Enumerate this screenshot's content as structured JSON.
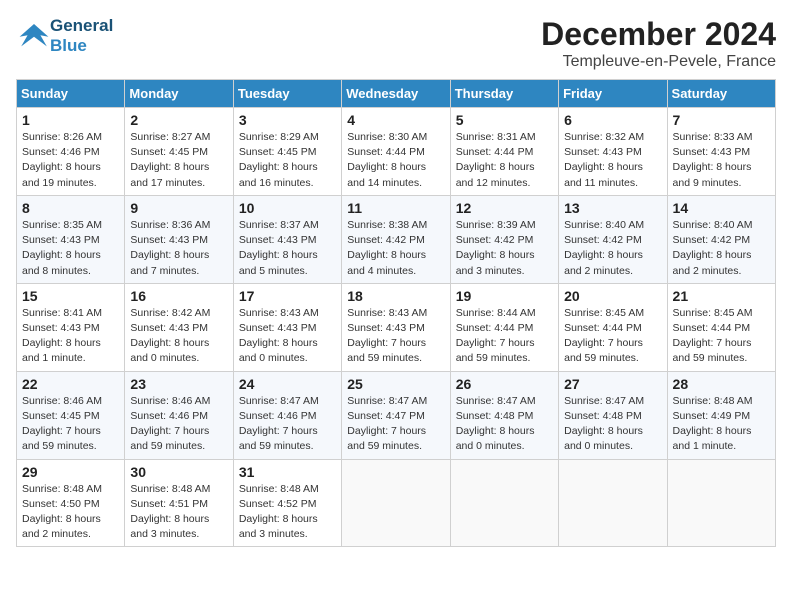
{
  "header": {
    "logo_general": "General",
    "logo_blue": "Blue",
    "month_title": "December 2024",
    "location": "Templeuve-en-Pevele, France"
  },
  "weekdays": [
    "Sunday",
    "Monday",
    "Tuesday",
    "Wednesday",
    "Thursday",
    "Friday",
    "Saturday"
  ],
  "weeks": [
    [
      {
        "day": "1",
        "info": "Sunrise: 8:26 AM\nSunset: 4:46 PM\nDaylight: 8 hours\nand 19 minutes."
      },
      {
        "day": "2",
        "info": "Sunrise: 8:27 AM\nSunset: 4:45 PM\nDaylight: 8 hours\nand 17 minutes."
      },
      {
        "day": "3",
        "info": "Sunrise: 8:29 AM\nSunset: 4:45 PM\nDaylight: 8 hours\nand 16 minutes."
      },
      {
        "day": "4",
        "info": "Sunrise: 8:30 AM\nSunset: 4:44 PM\nDaylight: 8 hours\nand 14 minutes."
      },
      {
        "day": "5",
        "info": "Sunrise: 8:31 AM\nSunset: 4:44 PM\nDaylight: 8 hours\nand 12 minutes."
      },
      {
        "day": "6",
        "info": "Sunrise: 8:32 AM\nSunset: 4:43 PM\nDaylight: 8 hours\nand 11 minutes."
      },
      {
        "day": "7",
        "info": "Sunrise: 8:33 AM\nSunset: 4:43 PM\nDaylight: 8 hours\nand 9 minutes."
      }
    ],
    [
      {
        "day": "8",
        "info": "Sunrise: 8:35 AM\nSunset: 4:43 PM\nDaylight: 8 hours\nand 8 minutes."
      },
      {
        "day": "9",
        "info": "Sunrise: 8:36 AM\nSunset: 4:43 PM\nDaylight: 8 hours\nand 7 minutes."
      },
      {
        "day": "10",
        "info": "Sunrise: 8:37 AM\nSunset: 4:43 PM\nDaylight: 8 hours\nand 5 minutes."
      },
      {
        "day": "11",
        "info": "Sunrise: 8:38 AM\nSunset: 4:42 PM\nDaylight: 8 hours\nand 4 minutes."
      },
      {
        "day": "12",
        "info": "Sunrise: 8:39 AM\nSunset: 4:42 PM\nDaylight: 8 hours\nand 3 minutes."
      },
      {
        "day": "13",
        "info": "Sunrise: 8:40 AM\nSunset: 4:42 PM\nDaylight: 8 hours\nand 2 minutes."
      },
      {
        "day": "14",
        "info": "Sunrise: 8:40 AM\nSunset: 4:42 PM\nDaylight: 8 hours\nand 2 minutes."
      }
    ],
    [
      {
        "day": "15",
        "info": "Sunrise: 8:41 AM\nSunset: 4:43 PM\nDaylight: 8 hours\nand 1 minute."
      },
      {
        "day": "16",
        "info": "Sunrise: 8:42 AM\nSunset: 4:43 PM\nDaylight: 8 hours\nand 0 minutes."
      },
      {
        "day": "17",
        "info": "Sunrise: 8:43 AM\nSunset: 4:43 PM\nDaylight: 8 hours\nand 0 minutes."
      },
      {
        "day": "18",
        "info": "Sunrise: 8:43 AM\nSunset: 4:43 PM\nDaylight: 7 hours\nand 59 minutes."
      },
      {
        "day": "19",
        "info": "Sunrise: 8:44 AM\nSunset: 4:44 PM\nDaylight: 7 hours\nand 59 minutes."
      },
      {
        "day": "20",
        "info": "Sunrise: 8:45 AM\nSunset: 4:44 PM\nDaylight: 7 hours\nand 59 minutes."
      },
      {
        "day": "21",
        "info": "Sunrise: 8:45 AM\nSunset: 4:44 PM\nDaylight: 7 hours\nand 59 minutes."
      }
    ],
    [
      {
        "day": "22",
        "info": "Sunrise: 8:46 AM\nSunset: 4:45 PM\nDaylight: 7 hours\nand 59 minutes."
      },
      {
        "day": "23",
        "info": "Sunrise: 8:46 AM\nSunset: 4:46 PM\nDaylight: 7 hours\nand 59 minutes."
      },
      {
        "day": "24",
        "info": "Sunrise: 8:47 AM\nSunset: 4:46 PM\nDaylight: 7 hours\nand 59 minutes."
      },
      {
        "day": "25",
        "info": "Sunrise: 8:47 AM\nSunset: 4:47 PM\nDaylight: 7 hours\nand 59 minutes."
      },
      {
        "day": "26",
        "info": "Sunrise: 8:47 AM\nSunset: 4:48 PM\nDaylight: 8 hours\nand 0 minutes."
      },
      {
        "day": "27",
        "info": "Sunrise: 8:47 AM\nSunset: 4:48 PM\nDaylight: 8 hours\nand 0 minutes."
      },
      {
        "day": "28",
        "info": "Sunrise: 8:48 AM\nSunset: 4:49 PM\nDaylight: 8 hours\nand 1 minute."
      }
    ],
    [
      {
        "day": "29",
        "info": "Sunrise: 8:48 AM\nSunset: 4:50 PM\nDaylight: 8 hours\nand 2 minutes."
      },
      {
        "day": "30",
        "info": "Sunrise: 8:48 AM\nSunset: 4:51 PM\nDaylight: 8 hours\nand 3 minutes."
      },
      {
        "day": "31",
        "info": "Sunrise: 8:48 AM\nSunset: 4:52 PM\nDaylight: 8 hours\nand 3 minutes."
      },
      {
        "day": "",
        "info": ""
      },
      {
        "day": "",
        "info": ""
      },
      {
        "day": "",
        "info": ""
      },
      {
        "day": "",
        "info": ""
      }
    ]
  ]
}
